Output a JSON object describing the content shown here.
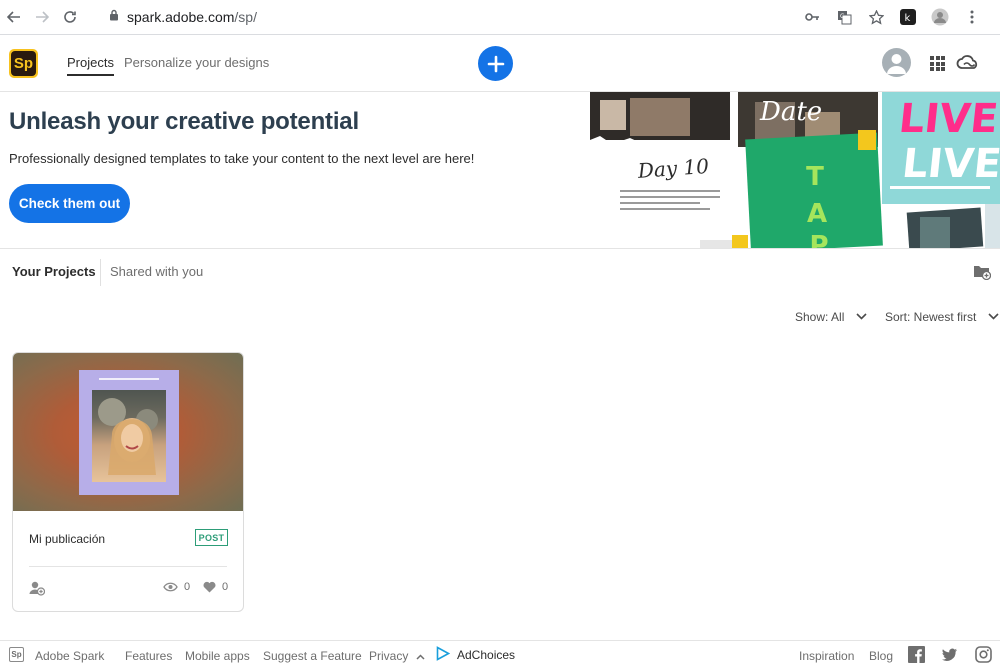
{
  "browser": {
    "url_host": "spark.adobe.com",
    "url_path": "/sp/"
  },
  "header": {
    "logo_text": "Sp",
    "tabs": [
      {
        "label": "Projects",
        "active": true
      },
      {
        "label": "Personalize your designs",
        "active": false
      }
    ],
    "create_icon": "plus-icon",
    "brand_color": "#1473e6"
  },
  "hero": {
    "title": "Unleash your creative potential",
    "subtitle": "Professionally designed templates to take your content to the next level are here!",
    "cta_label": "Check them out",
    "collage": {
      "day_text": "Day 10",
      "live_text": "LIVE",
      "tap_text": "TAP"
    }
  },
  "projects": {
    "tabs": [
      {
        "label": "Your Projects",
        "active": true
      },
      {
        "label": "Shared with you",
        "active": false
      }
    ],
    "show_filter": "Show: All",
    "sort_filter": "Sort: Newest first",
    "cards": [
      {
        "title": "Mi publicación",
        "type_badge": "POST",
        "views": "0",
        "likes": "0"
      }
    ]
  },
  "footer": {
    "logo_text": "Sp",
    "links": [
      "Adobe Spark",
      "Features",
      "Mobile apps",
      "Suggest a Feature",
      "Privacy"
    ],
    "adchoices": "AdChoices",
    "right_links": [
      "Inspiration",
      "Blog"
    ]
  }
}
